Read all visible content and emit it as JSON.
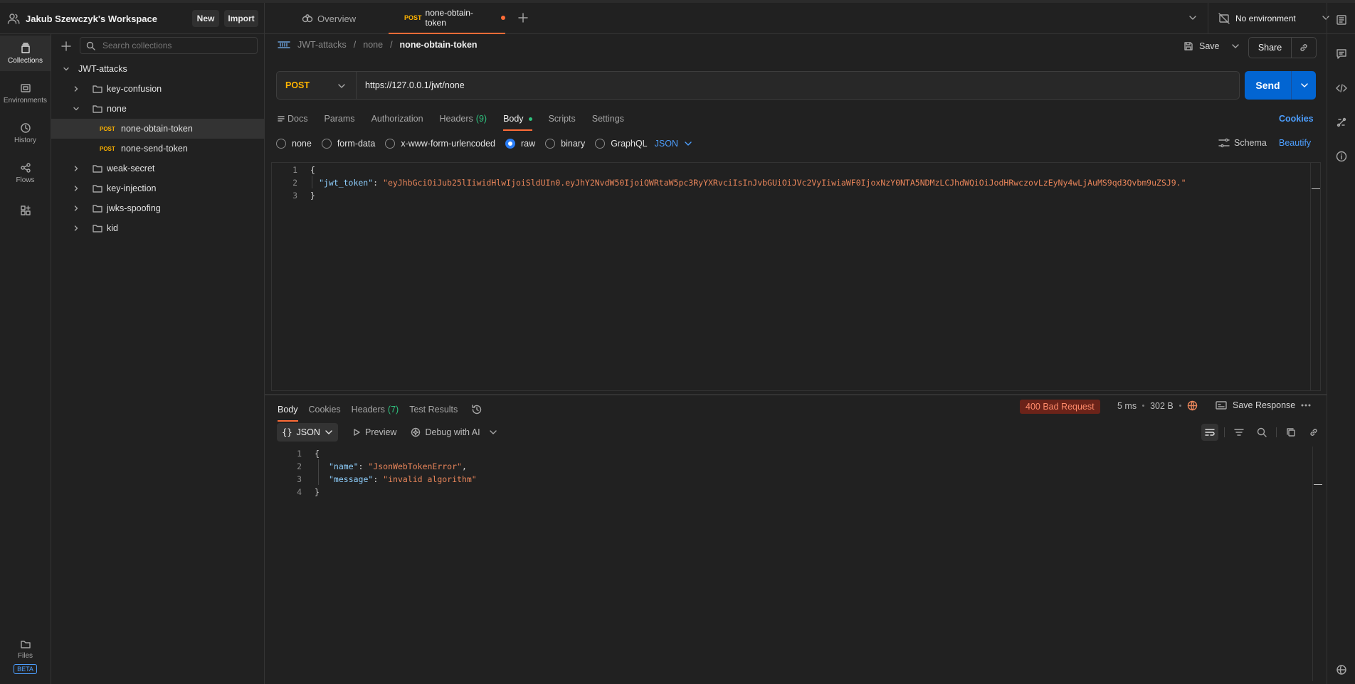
{
  "workspace": {
    "name": "Jakub Szewczyk's Workspace",
    "new_label": "New",
    "import_label": "Import"
  },
  "tabs": {
    "overview_label": "Overview",
    "active": {
      "method": "POST",
      "label": "none-obtain-token"
    }
  },
  "environment": {
    "label": "No environment"
  },
  "rail": {
    "collections": "Collections",
    "environments": "Environments",
    "history": "History",
    "flows": "Flows",
    "files": "Files",
    "beta": "BETA"
  },
  "sidebar": {
    "search_placeholder": "Search collections",
    "collection": "JWT-attacks",
    "items": [
      {
        "label": "key-confusion"
      },
      {
        "label": "none"
      },
      {
        "method": "POST",
        "label": "none-obtain-token"
      },
      {
        "method": "POST",
        "label": "none-send-token"
      },
      {
        "label": "weak-secret"
      },
      {
        "label": "key-injection"
      },
      {
        "label": "jwks-spoofing"
      },
      {
        "label": "kid"
      }
    ]
  },
  "breadcrumb": {
    "part1": "JWT-attacks",
    "part2": "none",
    "current": "none-obtain-token"
  },
  "actions": {
    "save": "Save",
    "share": "Share"
  },
  "request": {
    "method": "POST",
    "url": "https://127.0.0.1/jwt/none",
    "send": "Send",
    "tabs": {
      "docs": "Docs",
      "params": "Params",
      "authorization": "Authorization",
      "headers": "Headers",
      "headers_count": "(9)",
      "body": "Body",
      "scripts": "Scripts",
      "settings": "Settings"
    },
    "cookies": "Cookies",
    "body_types": {
      "none": "none",
      "form_data": "form-data",
      "urlencoded": "x-www-form-urlencoded",
      "raw": "raw",
      "binary": "binary",
      "graphql": "GraphQL",
      "format": "JSON"
    },
    "schema": "Schema",
    "beautify": "Beautify",
    "body_lines": {
      "l1_num": "1",
      "l2_num": "2",
      "l3_num": "3",
      "open": "{",
      "close": "}",
      "key": "\"jwt_token\"",
      "colon": ": ",
      "value": "\"eyJhbGciOiJub25lIiwidHlwIjoiSldUIn0.eyJhY2NvdW50IjoiQWRtaW5pc3RyYXRvciIsInJvbGUiOiJVc2VyIiwiaWF0IjoxNzY0NTA5NDMzLCJhdWQiOiJodHRwczovLzEyNy4wLjAuMS9qd3Qvbm9uZSJ9.\""
    }
  },
  "response": {
    "tabs": {
      "body": "Body",
      "cookies": "Cookies",
      "headers": "Headers",
      "headers_count": "(7)",
      "test_results": "Test Results"
    },
    "status": "400 Bad Request",
    "time": "5 ms",
    "size": "302 B",
    "save_response": "Save Response",
    "format": "JSON",
    "preview": "Preview",
    "debug": "Debug with AI",
    "lines": {
      "n1": "1",
      "n2": "2",
      "n3": "3",
      "n4": "4",
      "open": "{",
      "close": "}",
      "name_key": "\"name\"",
      "name_val": "\"JsonWebTokenError\"",
      "message_key": "\"message\"",
      "message_val": "\"invalid algorithm\"",
      "colon": ": ",
      "comma": ","
    }
  }
}
